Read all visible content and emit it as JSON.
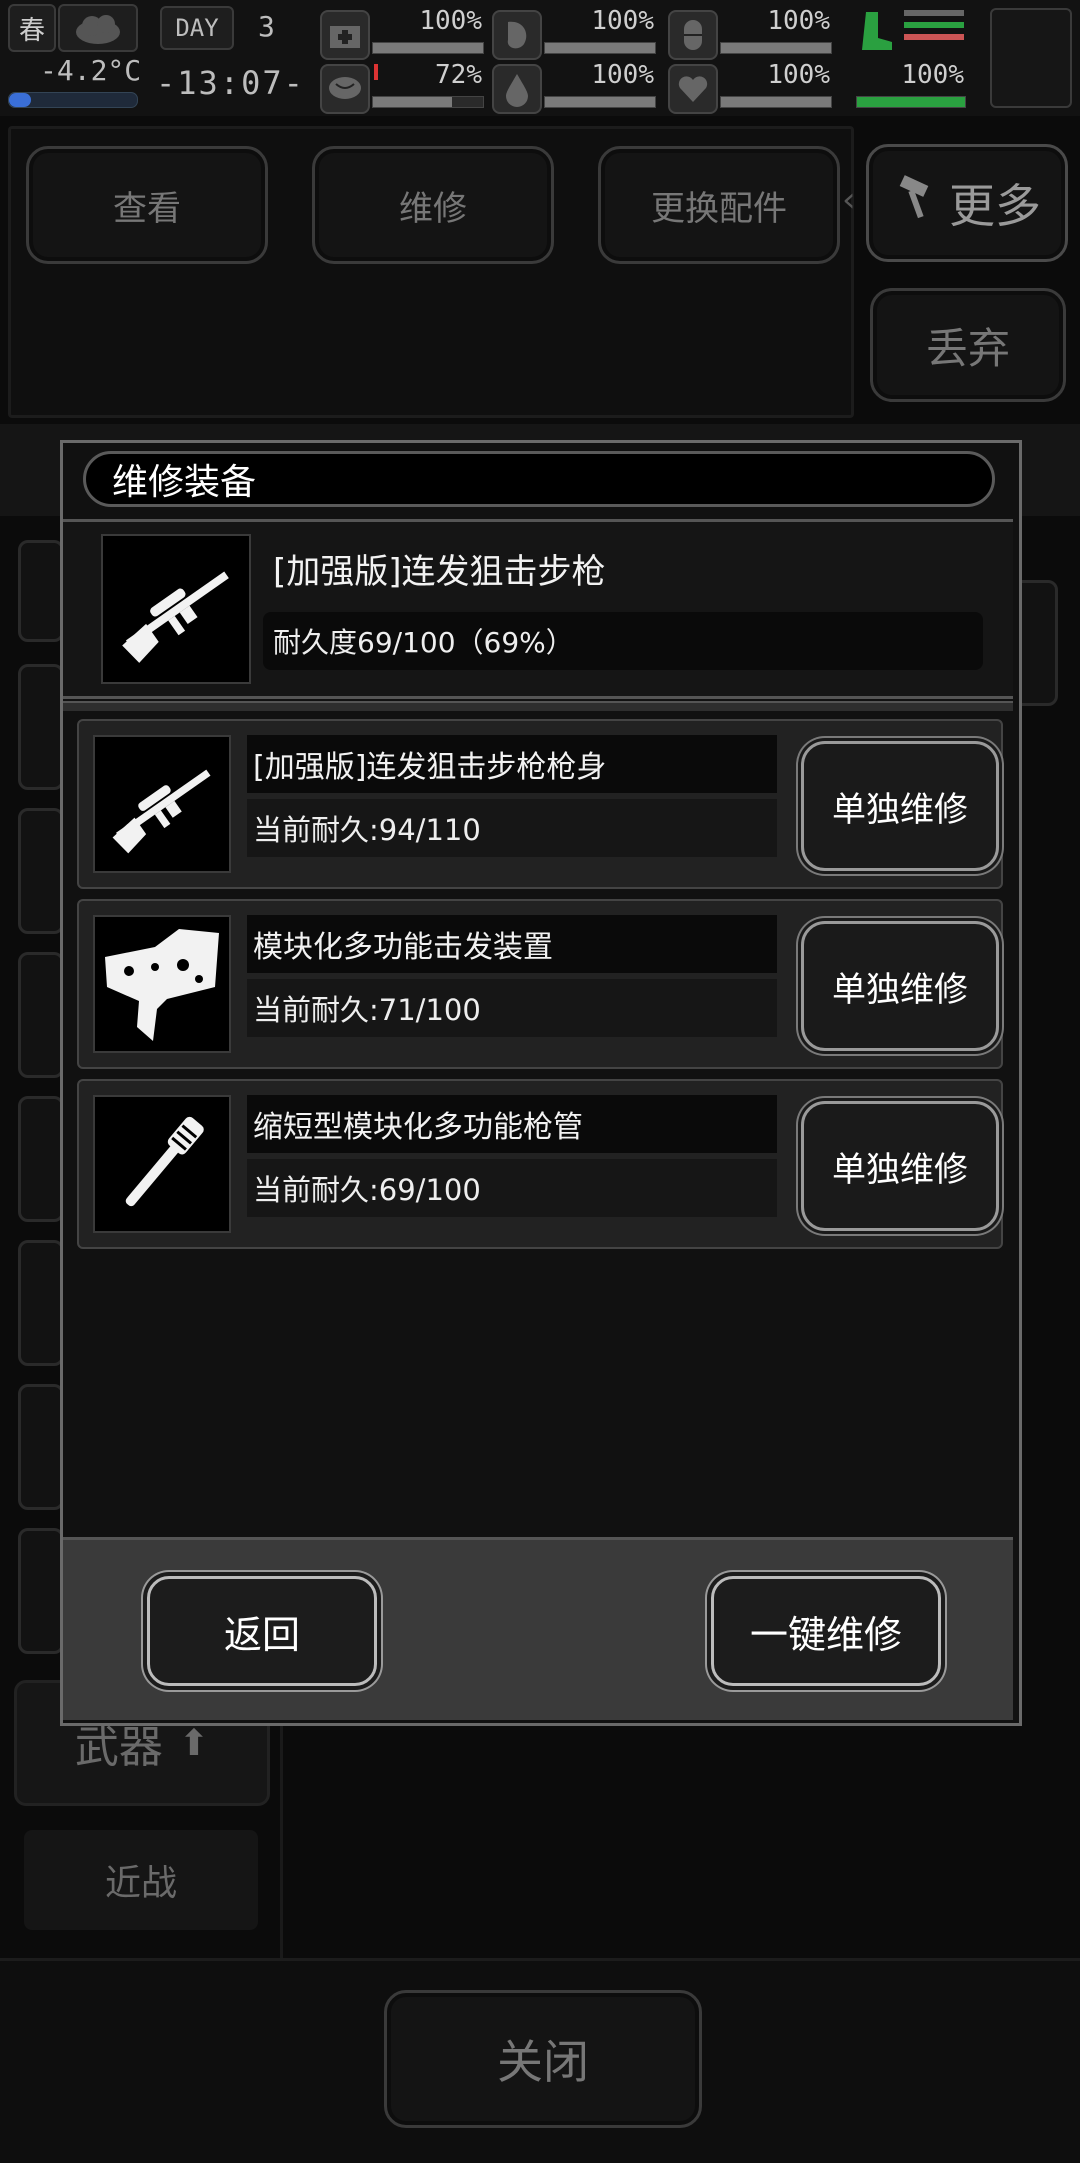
{
  "status": {
    "season": "春",
    "temperature": "-4.2°C",
    "day_label": "DAY",
    "day_number": "3",
    "time": "-13:07-",
    "stats": [
      {
        "name": "health",
        "value": "100%",
        "level": 1.0
      },
      {
        "name": "hunger",
        "value": "100%",
        "level": 1.0
      },
      {
        "name": "fatigue",
        "value": "100%",
        "level": 1.0
      },
      {
        "name": "mental",
        "value": "72%",
        "level": 0.72
      },
      {
        "name": "thirst",
        "value": "100%",
        "level": 1.0
      },
      {
        "name": "mood",
        "value": "100%",
        "level": 1.0
      },
      {
        "name": "stamina",
        "value": "100%",
        "level": 1.0
      }
    ]
  },
  "background": {
    "tabs": [
      "查看",
      "维修",
      "更换配件"
    ],
    "more_label": "更多",
    "discard_label": "丢弃",
    "category_weapon": "武器",
    "category_melee": "近战",
    "close_label": "关闭"
  },
  "modal": {
    "title": "维修装备",
    "item_name": "[加强版]连发狙击步枪",
    "item_durability": "耐久度69/100（69%）",
    "parts": [
      {
        "name": "[加强版]连发狙击步枪枪身",
        "durability": "当前耐久:94/110",
        "button": "单独维修",
        "icon": "sniper-rifle-icon"
      },
      {
        "name": "模块化多功能击发装置",
        "durability": "当前耐久:71/100",
        "button": "单独维修",
        "icon": "trigger-mechanism-icon"
      },
      {
        "name": "缩短型模块化多功能枪管",
        "durability": "当前耐久:69/100",
        "button": "单独维修",
        "icon": "gun-barrel-icon"
      }
    ],
    "back_label": "返回",
    "repair_all_label": "一键维修"
  }
}
